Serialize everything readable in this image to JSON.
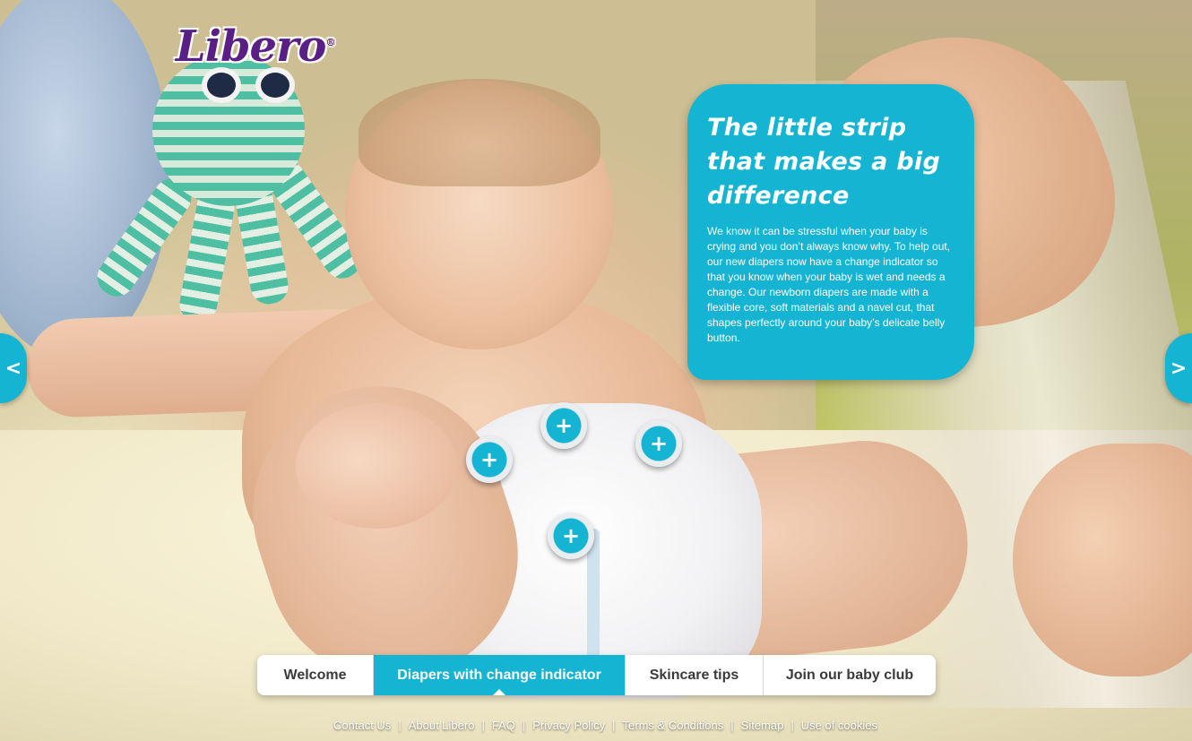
{
  "brand": {
    "logo_text": "Libero",
    "logo_mark": "®",
    "logo_color": "#5a1f84"
  },
  "theme": {
    "accent": "#16b4d3"
  },
  "info_card": {
    "title": "The little strip that makes a big difference",
    "body": "We know it can be stressful when your baby is crying and you don’t always know why. To help out, our new diapers now have a change indicator so that you know when your baby is wet and needs a change. Our newborn diapers are made with a flexible core, soft materials and a navel cut, that shapes perfectly around your baby’s delicate belly button."
  },
  "carousel": {
    "prev_label": "<",
    "next_label": ">"
  },
  "hotspots": [
    {
      "label": "+",
      "icon": "plus-icon"
    },
    {
      "label": "+",
      "icon": "plus-icon"
    },
    {
      "label": "+",
      "icon": "plus-icon"
    },
    {
      "label": "+",
      "icon": "plus-icon"
    }
  ],
  "tabs": [
    {
      "label": "Welcome",
      "active": false
    },
    {
      "label": "Diapers with change indicator",
      "active": true
    },
    {
      "label": "Skincare tips",
      "active": false
    },
    {
      "label": "Join our baby club",
      "active": false
    }
  ],
  "footer": {
    "links": [
      "Contact Us",
      "About Libero",
      "FAQ",
      "Privacy Policy",
      "Terms & Conditions",
      "Sitemap",
      "Use of cookies"
    ],
    "separator": "|"
  }
}
